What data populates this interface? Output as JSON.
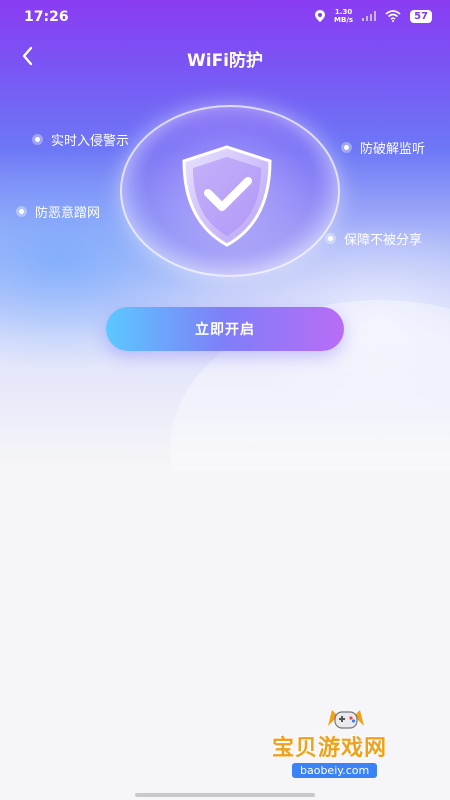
{
  "status_bar": {
    "time": "17:26",
    "speed_value": "1.30",
    "speed_unit": "MB/s",
    "battery": "57",
    "icons": [
      "location-icon",
      "speed-indicator",
      "signal-icon",
      "wifi-icon",
      "battery-icon"
    ]
  },
  "header": {
    "title": "WiFi防护",
    "back_icon": "chevron-left-icon"
  },
  "hero": {
    "shield_icon": "shield-check-icon",
    "features": [
      "实时入侵警示",
      "防破解监听",
      "防恶意蹭网",
      "保障不被分享"
    ]
  },
  "cta": {
    "label": "立即开启"
  },
  "watermark": {
    "text": "宝贝游戏网",
    "url": "baobeiy.com"
  },
  "colors": {
    "accent_purple": "#8a3cf2",
    "button_start": "#5cc8ff",
    "button_end": "#b96cf6",
    "watermark_orange": "#f0a11b"
  }
}
